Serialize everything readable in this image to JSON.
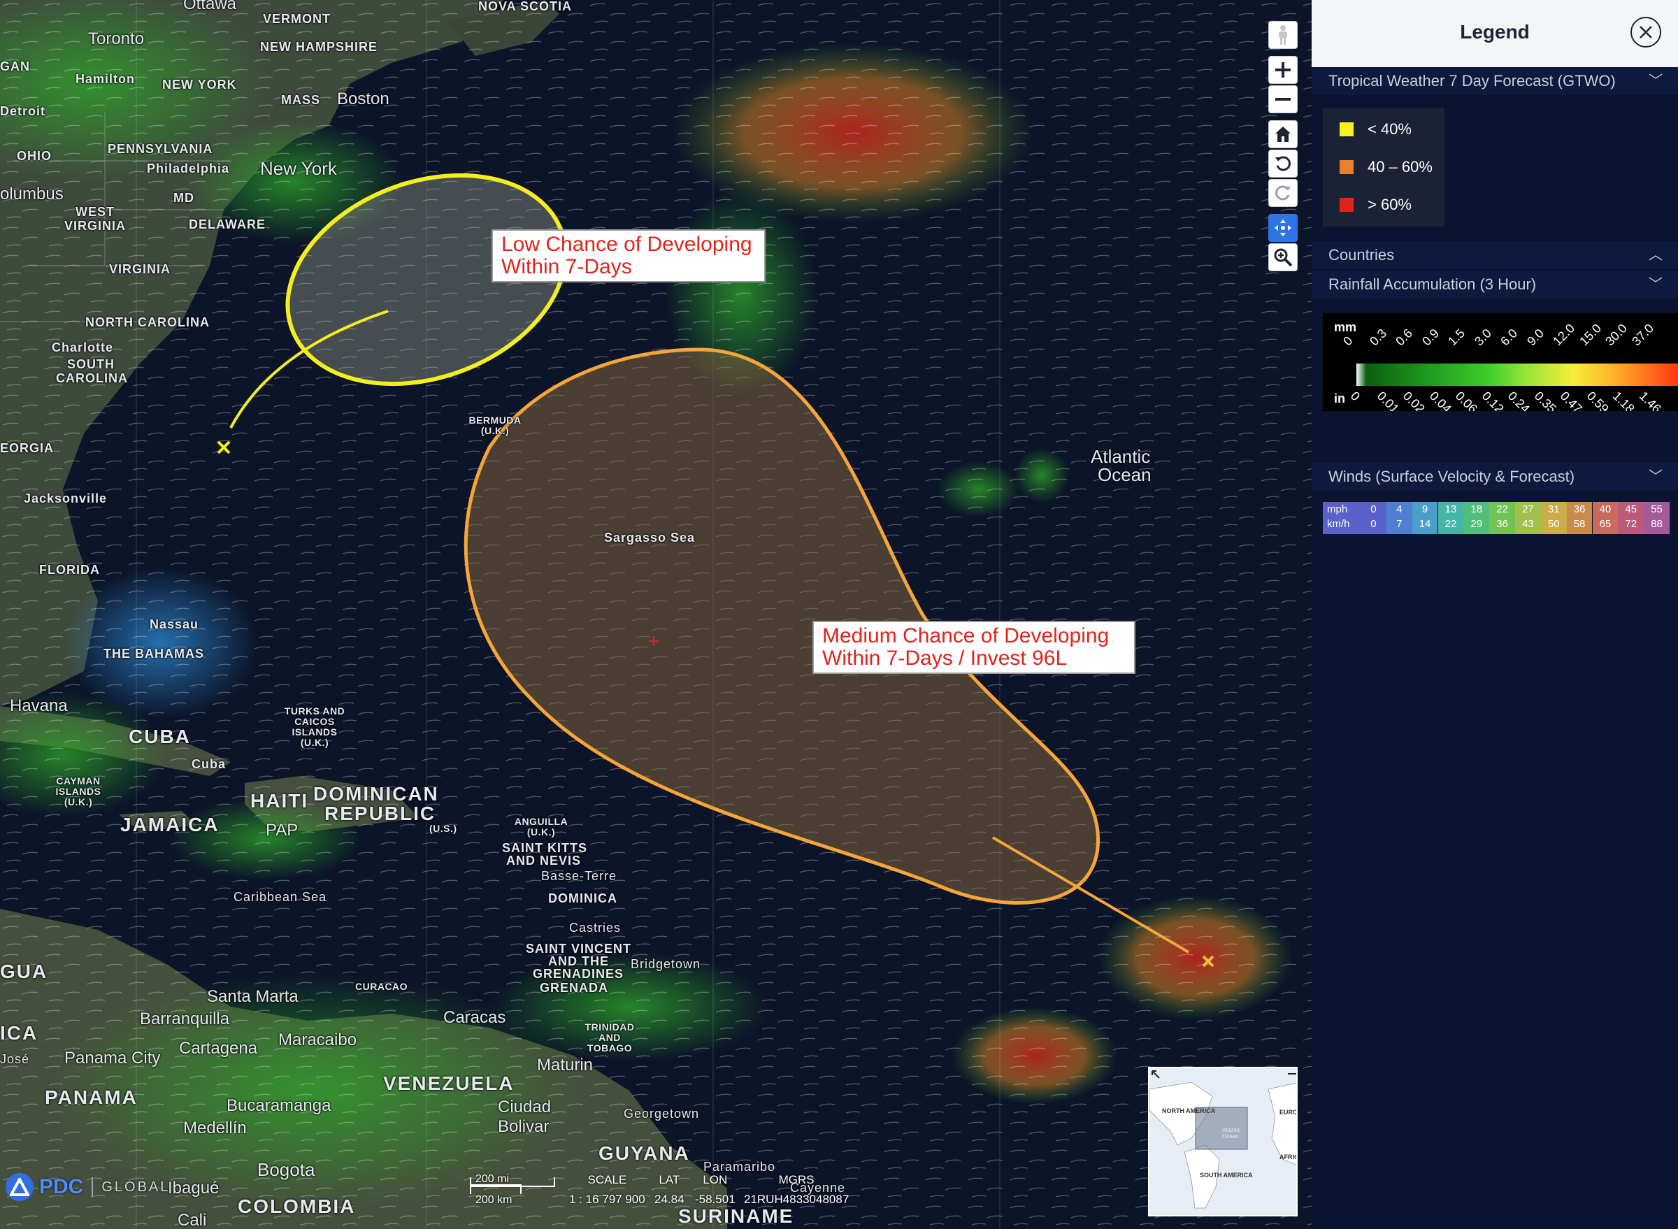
{
  "map": {
    "callouts": {
      "low": [
        "Low Chance of Developing",
        "Within 7-Days"
      ],
      "medium": [
        "Medium Chance of Developing",
        "Within 7-Days / Invest 96L"
      ]
    },
    "place_labels": {
      "ottawa": "Ottawa",
      "vermont": "VERMONT",
      "nova_scotia": "NOVA SCOTIA",
      "toronto": "Toronto",
      "hamilton": "Hamilton",
      "new_hampshire": "NEW HAMPSHIRE",
      "gan": "GAN",
      "new_york_state": "NEW YORK",
      "mass": "MASS",
      "boston": "Boston",
      "detroit": "Detroit",
      "pennsylvania": "PENNSYLVANIA",
      "ohio": "OHIO",
      "philadelphia": "Philadelphia",
      "new_york_city": "New York",
      "columbus": "olumbus",
      "md": "MD",
      "west": "WEST",
      "virginia_w": "VIRGINIA",
      "delaware": "DELAWARE",
      "virginia": "VIRGINIA",
      "north_carolina": "NORTH CAROLINA",
      "charlotte": "Charlotte",
      "south": "SOUTH",
      "carolina": "CAROLINA",
      "georgia": "EORGIA",
      "jacksonville": "Jacksonville",
      "florida": "FLORIDA",
      "nassau": "Nassau",
      "bahamas": "THE BAHAMAS",
      "havana": "Havana",
      "cuba": "CUBA",
      "cuba_city": "Cuba",
      "turks": "TURKS AND CAICOS ISLANDS (U.K.)",
      "cayman": "CAYMAN ISLANDS (U.K.)",
      "haiti": "HAITI",
      "dominican": "DOMINICAN",
      "republic": "REPUBLIC",
      "pap": "PAP",
      "jamaica": "JAMAICA",
      "us_vi": "(U.S.)",
      "anguilla": "ANGUILLA (U.K.)",
      "saint_kitts": "SAINT KITTS",
      "and_nevis": "AND NEVIS",
      "basse_terre": "Basse-Terre",
      "dominica": "DOMINICA",
      "castries": "Castries",
      "saint_vincent": "SAINT VINCENT",
      "and_the": "AND THE",
      "grenadines": "GRENADINES",
      "grenada": "GRENADA",
      "bridgetown": "Bridgetown",
      "caribbean_sea": "Caribbean Sea",
      "bermuda": "BERMUDA (U.K.)",
      "sargasso": "Sargasso Sea",
      "atlantic": "Atlantic",
      "ocean": "Ocean",
      "gua": "GUA",
      "santa_marta": "Santa Marta",
      "curacao": "CURACAO",
      "barranquilla": "Barranquilla",
      "ica": "ICA",
      "caracas": "Caracas",
      "trinidad": "TRINIDAD AND TOBAGO",
      "cartagena": "Cartagena",
      "maracaibo": "Maracaibo",
      "jose": "José",
      "panama_city": "Panama City",
      "maturin": "Maturin",
      "venezuela": "VENEZUELA",
      "panama": "PANAMA",
      "ciudad": "Ciudad",
      "bolivar": "Bolivar",
      "georgetown": "Georgetown",
      "bucaramanga": "Bucaramanga",
      "medellin": "Medellín",
      "guyana": "GUYANA",
      "paramaribo": "Paramaribo",
      "bogota": "Bogota",
      "ibague": "Ibagué",
      "cayenne": "Cayenne",
      "colombia": "COLOMBIA",
      "suriname": "SURINAME",
      "cali": "Cali"
    },
    "logo": {
      "brand": "PDC",
      "tag": "GLOBAL"
    },
    "scale": {
      "mi": "200 mi",
      "km": "200 km"
    },
    "readout": {
      "scale_label": "SCALE",
      "scale_value": "1 : 16 797 900",
      "lat_label": "LAT",
      "lat_value": "24.84",
      "lon_label": "LON",
      "lon_value": "-58.501",
      "mgrs_label": "MGRS",
      "mgrs_value": "21RUH4833048087"
    },
    "overview": {
      "north_america": "NORTH AMERICA",
      "south_america": "SOUTH AMERICA",
      "europe": "EUROI",
      "africa": "AFRIC",
      "atlantic": "Atlantic Ocean"
    },
    "toolbar_icons": [
      "pegman-icon",
      "zoom-in-icon",
      "zoom-out-icon",
      "home-icon",
      "rotate-left-icon",
      "rotate-right-icon",
      "pan-move-icon",
      "zoom-search-icon"
    ]
  },
  "legend": {
    "title": "Legend",
    "sections": {
      "gtwo": "Tropical Weather 7 Day Forecast (GTWO)",
      "countries": "Countries",
      "rainfall": "Rainfall Accumulation (3 Hour)",
      "winds": "Winds (Surface Velocity & Forecast)"
    },
    "gtwo_items": [
      {
        "label": "< 40%",
        "color": "#f7f01e"
      },
      {
        "label": "40 – 60%",
        "color": "#e8822a"
      },
      {
        "label": "> 60%",
        "color": "#e3241b"
      }
    ],
    "rainfall": {
      "unit_top": "mm",
      "unit_bottom": "in",
      "mm_ticks": [
        "0",
        "0.3",
        "0.6",
        "0.9",
        "1.5",
        "3.0",
        "6.0",
        "9.0",
        "12.0",
        "15.0",
        "30.0",
        "37.0"
      ],
      "in_ticks": [
        "0",
        "0.01",
        "0.02",
        "0.04",
        "0.06",
        "0.12",
        "0.24",
        "0.35",
        "0.47",
        "0.59",
        "1.18",
        "1.46"
      ]
    },
    "winds": {
      "unit_mph": "mph",
      "unit_kmh": "km/h",
      "mph": [
        "0",
        "4",
        "9",
        "13",
        "18",
        "22",
        "27",
        "31",
        "36",
        "40",
        "45",
        "55"
      ],
      "kmh": [
        "0",
        "7",
        "14",
        "22",
        "29",
        "36",
        "43",
        "50",
        "58",
        "65",
        "72",
        "88"
      ],
      "colors": [
        "#5a62c9",
        "#4f7fd0",
        "#4a9fca",
        "#45b5a6",
        "#4fbf79",
        "#72c255",
        "#a2bf4d",
        "#c8ad49",
        "#c98a4a",
        "#c86b5a",
        "#bb5a7a",
        "#a65a9c"
      ]
    }
  }
}
